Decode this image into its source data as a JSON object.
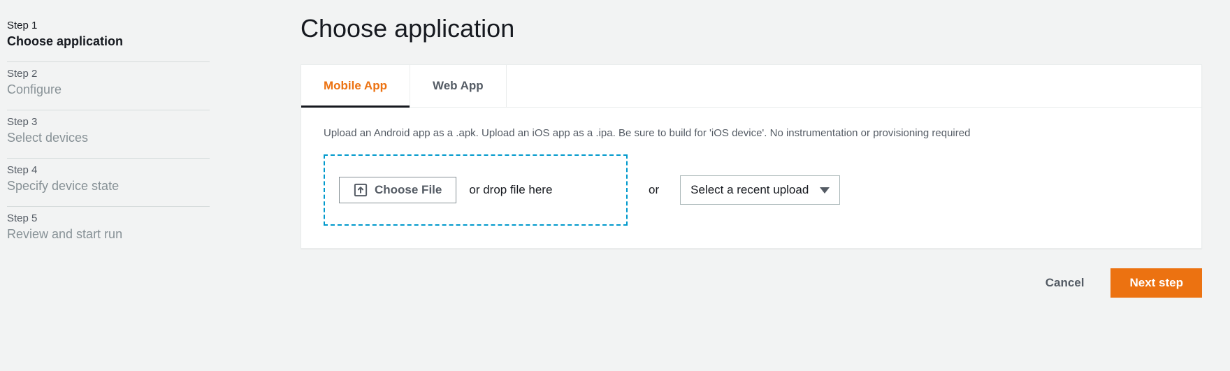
{
  "sidebar": {
    "steps": [
      {
        "label": "Step 1",
        "title": "Choose application",
        "active": true
      },
      {
        "label": "Step 2",
        "title": "Configure",
        "active": false
      },
      {
        "label": "Step 3",
        "title": "Select devices",
        "active": false
      },
      {
        "label": "Step 4",
        "title": "Specify device state",
        "active": false
      },
      {
        "label": "Step 5",
        "title": "Review and start run",
        "active": false
      }
    ]
  },
  "main": {
    "title": "Choose application",
    "tabs": [
      {
        "label": "Mobile App",
        "active": true
      },
      {
        "label": "Web App",
        "active": false
      }
    ],
    "instruction": "Upload an Android app as a .apk. Upload an iOS app as a .ipa. Be sure to build for 'iOS device'. No instrumentation or provisioning required",
    "choose_file_label": "Choose File",
    "drop_text": "or drop file here",
    "or_text": "or",
    "select_recent_label": "Select a recent upload",
    "cancel_label": "Cancel",
    "next_label": "Next step"
  }
}
